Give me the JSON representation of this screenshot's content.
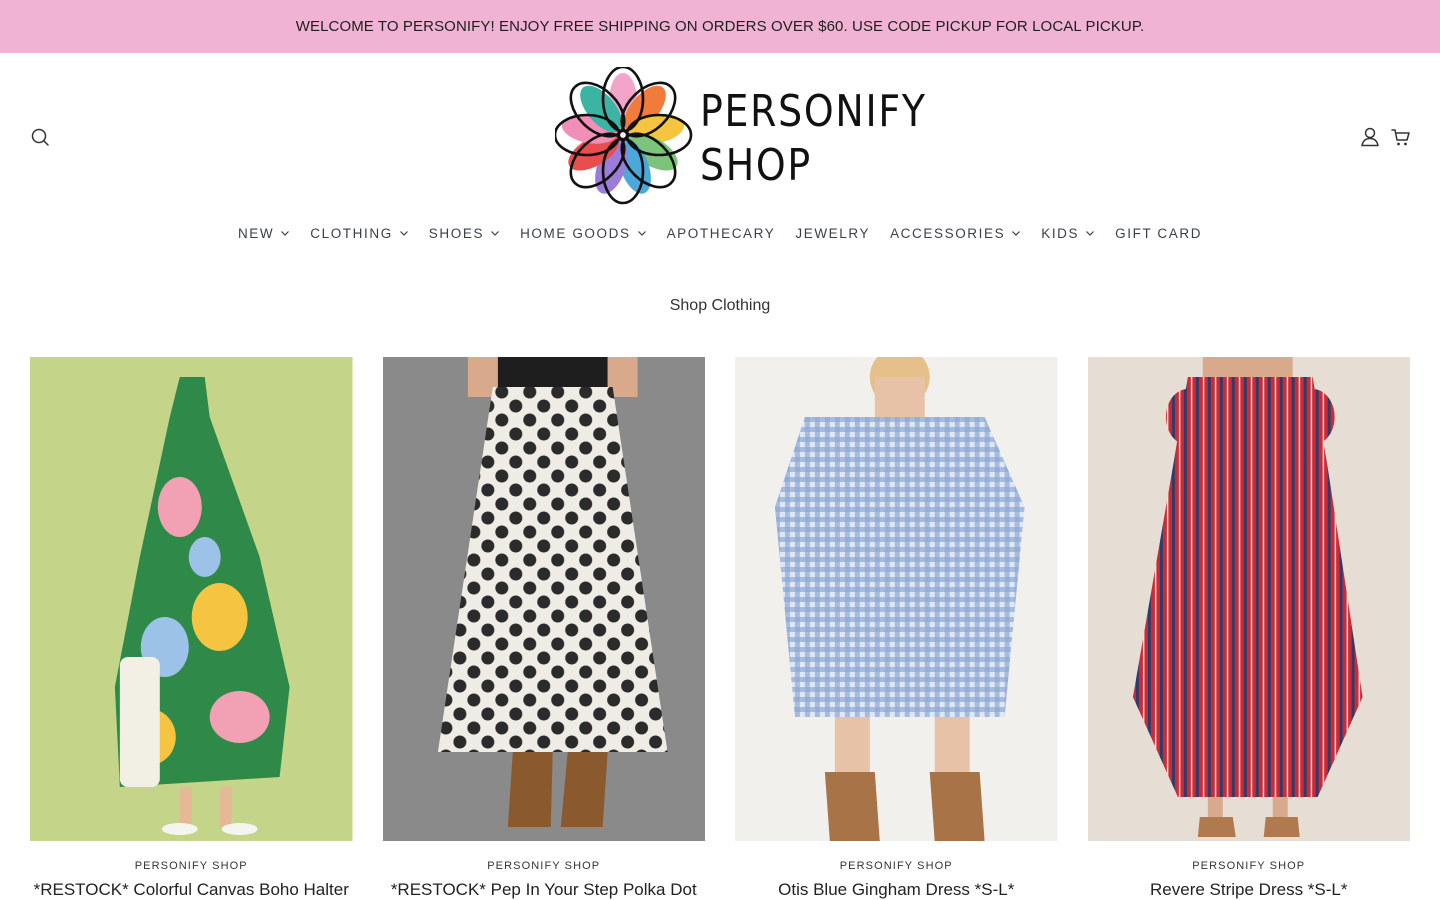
{
  "announcement": "WELCOME TO PERSONIFY! ENJOY FREE SHIPPING ON ORDERS OVER $60. USE CODE PICKUP FOR LOCAL PICKUP.",
  "colors": {
    "announcement_bg": "#f1b3d4",
    "nav_text": "#3a3f4a"
  },
  "header": {
    "logo_text_line1": "PERSONIFY",
    "logo_text_line2": "SHOP",
    "icons": {
      "search": "search-icon",
      "account": "account-icon",
      "cart": "cart-icon"
    }
  },
  "nav": [
    {
      "label": "NEW",
      "has_dropdown": true
    },
    {
      "label": "CLOTHING",
      "has_dropdown": true
    },
    {
      "label": "SHOES",
      "has_dropdown": true
    },
    {
      "label": "HOME GOODS",
      "has_dropdown": true
    },
    {
      "label": "APOTHECARY",
      "has_dropdown": false
    },
    {
      "label": "JEWELRY",
      "has_dropdown": false
    },
    {
      "label": "ACCESSORIES",
      "has_dropdown": true
    },
    {
      "label": "KIDS",
      "has_dropdown": true
    },
    {
      "label": "GIFT CARD",
      "has_dropdown": false
    }
  ],
  "page_title": "Shop Clothing",
  "products": [
    {
      "vendor": "PERSONIFY SHOP",
      "name": "*RESTOCK* Colorful Canvas Boho Halter"
    },
    {
      "vendor": "PERSONIFY SHOP",
      "name": "*RESTOCK* Pep In Your Step Polka Dot"
    },
    {
      "vendor": "PERSONIFY SHOP",
      "name": "Otis Blue Gingham Dress *S-L*"
    },
    {
      "vendor": "PERSONIFY SHOP",
      "name": "Revere Stripe Dress *S-L*"
    }
  ]
}
